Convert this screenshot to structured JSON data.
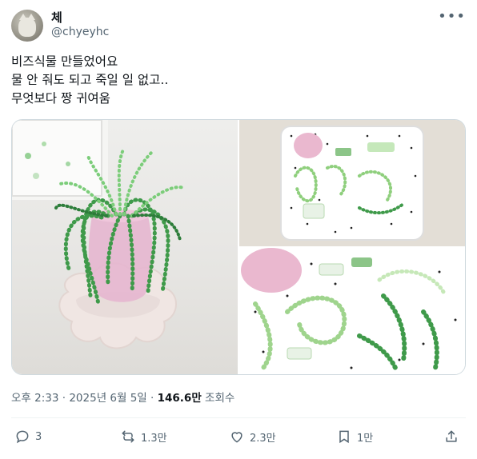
{
  "author": {
    "display_name": "체",
    "handle": "@chyeyhc"
  },
  "post": {
    "lines": [
      "비즈식물 만들었어요",
      "물 안 줘도 되고 죽일 일 없고..",
      "무엇보다 짱 귀여움"
    ]
  },
  "media": {
    "images": [
      "plant-photo",
      "tray-photo",
      "beads-closeup-photo"
    ]
  },
  "meta": {
    "time": "오후 2:33",
    "date": "2025년 6월 5일",
    "separator": "·",
    "views_count": "146.6만",
    "views_label": "조회수"
  },
  "actions": {
    "reply_count": "3",
    "repost_count": "1.3만",
    "like_count": "2.3만",
    "bookmark_count": "1만"
  },
  "colors": {
    "text": "#0f1419",
    "muted": "#536471",
    "bead_green": "#3f9a4a",
    "vase_pink": "#e6b6cf"
  }
}
